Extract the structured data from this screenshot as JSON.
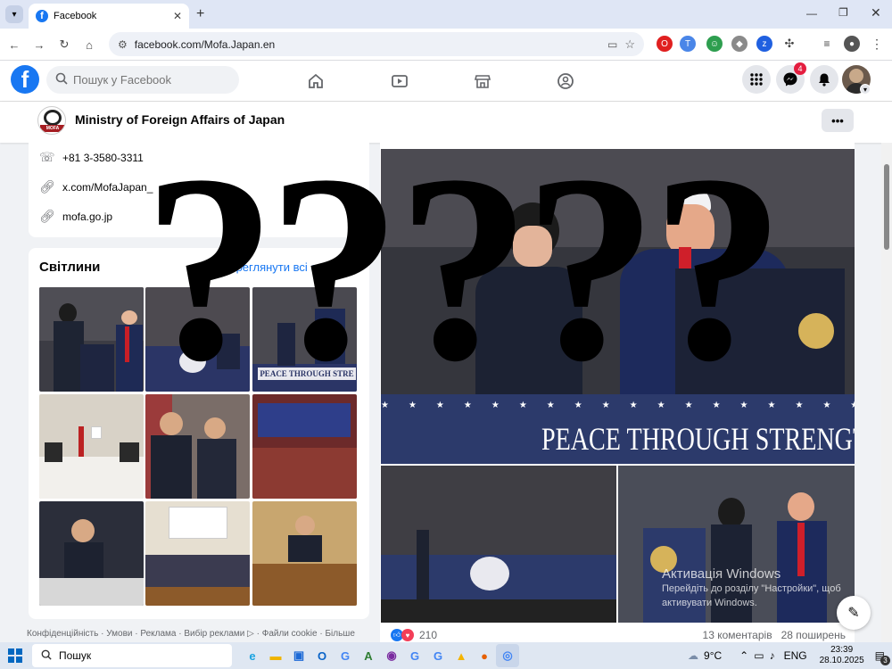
{
  "browser": {
    "tab_title": "Facebook",
    "url": "facebook.com/Mofa.Japan.en"
  },
  "fb": {
    "logo": "f",
    "search_placeholder": "Пошук у Facebook",
    "messenger_badge": "4"
  },
  "page": {
    "name": "Ministry of Foreign Affairs of Japan",
    "logo_text": "MOFA",
    "more_label": "•••"
  },
  "intro": {
    "phone": "+81 3-3580-3311",
    "twitter": "x.com/MofaJapan_",
    "website": "mofa.go.jp"
  },
  "photos": {
    "title": "Світлини",
    "see_all": "Переглянути всі світлини"
  },
  "post": {
    "banner_text": "PEACE THROUGH STRENGTH",
    "reactions_count": "210",
    "comments": "13 коментарів",
    "shares": "28 поширень"
  },
  "footer": "Конфіденційність · Умови · Реклама · Вибір реклами ▷ · Файли cookie · Більше",
  "watermark": {
    "title": "Активація Windows",
    "line1": "Перейдіть до розділу \"Настройки\", щоб",
    "line2": "активувати Windows."
  },
  "overlay": {
    "marks": [
      "?",
      "?",
      "?",
      "?",
      "?"
    ]
  },
  "taskbar": {
    "search_label": "Пошук",
    "weather": "9°C",
    "lang": "ENG",
    "time": "23:39",
    "date": "28.10.2025",
    "notif_count": "3"
  },
  "colors": {
    "fb_blue": "#1877f2",
    "badge_red": "#e41e3f",
    "banner_navy": "#2c3a6b"
  }
}
